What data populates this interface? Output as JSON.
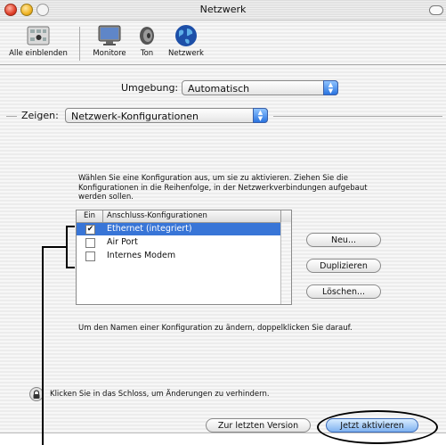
{
  "window": {
    "title": "Netzwerk"
  },
  "toolbar": {
    "items": [
      {
        "label": "Alle einblenden",
        "icon": "apple-grid-icon"
      },
      {
        "label": "Monitore",
        "icon": "monitor-icon"
      },
      {
        "label": "Ton",
        "icon": "speaker-icon"
      },
      {
        "label": "Netzwerk",
        "icon": "globe-icon"
      }
    ]
  },
  "location": {
    "label": "Umgebung:",
    "value": "Automatisch"
  },
  "show": {
    "label": "Zeigen:",
    "value": "Netzwerk-Konfigurationen"
  },
  "instructions": "Wählen Sie eine Konfiguration aus, um sie zu aktivieren. Ziehen Sie die Konfigurationen in die Reihenfolge, in der Netzwerkverbindungen aufgebaut werden sollen.",
  "table": {
    "headers": [
      "Ein",
      "Anschluss-Konfigurationen"
    ],
    "rows": [
      {
        "name": "Ethernet (integriert)",
        "checked": "✔",
        "selected": true
      },
      {
        "name": "Air Port",
        "checked": "",
        "selected": false
      },
      {
        "name": "Internes Modem",
        "checked": "",
        "selected": false
      }
    ]
  },
  "side_buttons": {
    "new": "Neu...",
    "duplicate": "Duplizieren",
    "delete": "Löschen..."
  },
  "rename_hint": "Um den Namen einer Konfiguration zu ändern, doppelklicken Sie darauf.",
  "lock_text": "Klicken Sie in das Schloss, um Änderungen zu verhindern.",
  "footer": {
    "revert": "Zur letzten Version",
    "apply": "Jetzt aktivieren"
  },
  "colors": {
    "selection": "#3875d7",
    "accent": "#2a74e0"
  }
}
